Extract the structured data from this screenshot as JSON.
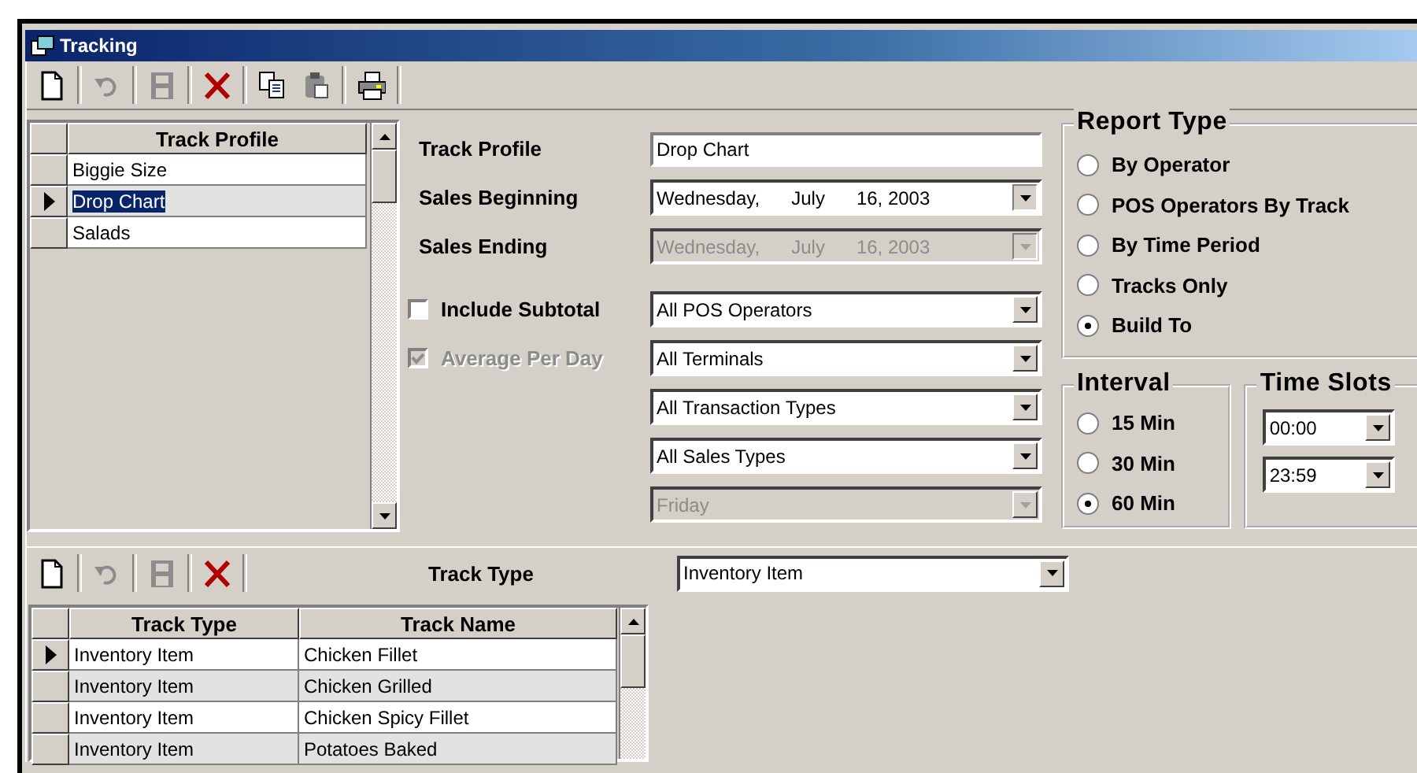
{
  "window": {
    "title": "Tracking"
  },
  "toolbar": {
    "groups": [
      {
        "items": [
          {
            "kind": "new",
            "disabled": false
          }
        ]
      },
      {
        "items": [
          {
            "kind": "undo",
            "disabled": true
          }
        ]
      },
      {
        "items": [
          {
            "kind": "save",
            "disabled": true
          }
        ]
      },
      {
        "items": [
          {
            "kind": "delete",
            "disabled": false
          }
        ]
      },
      {
        "items": [
          {
            "kind": "copy",
            "disabled": false
          },
          {
            "kind": "paste",
            "disabled": true
          }
        ]
      },
      {
        "items": [
          {
            "kind": "print",
            "disabled": false
          }
        ]
      }
    ]
  },
  "profile_grid": {
    "column": "Track Profile",
    "rows": [
      {
        "name": "Biggie Size",
        "selected": false
      },
      {
        "name": "Drop Chart",
        "selected": true
      },
      {
        "name": "Salads",
        "selected": false
      }
    ]
  },
  "form": {
    "fields": [
      {
        "label": "Track Profile",
        "kind": "text",
        "value": "Drop Chart",
        "disabled": false
      },
      {
        "label": "Sales Beginning",
        "kind": "date",
        "value": "Wednesday,      July      16, 2003",
        "disabled": false
      },
      {
        "label": "Sales Ending",
        "kind": "date",
        "value": "Wednesday,      July      16, 2003",
        "disabled": true
      }
    ],
    "options": [
      {
        "checkbox": {
          "label": "Include Subtotal",
          "checked": false,
          "disabled": false
        },
        "dropdown": {
          "value": "All POS Operators",
          "disabled": false
        }
      },
      {
        "checkbox": {
          "label": "Average Per Day",
          "checked": true,
          "disabled": true
        },
        "dropdown": {
          "value": "All Terminals",
          "disabled": false
        }
      },
      {
        "dropdown": {
          "value": "All Transaction Types",
          "disabled": false
        }
      },
      {
        "dropdown": {
          "value": "All Sales Types",
          "disabled": false
        }
      },
      {
        "dropdown": {
          "value": "Friday",
          "disabled": true
        }
      }
    ]
  },
  "report_type": {
    "title": "Report Type",
    "options": [
      {
        "label": "By Operator",
        "selected": false
      },
      {
        "label": "POS Operators By Track",
        "selected": false
      },
      {
        "label": "By Time Period",
        "selected": false
      },
      {
        "label": "Tracks Only",
        "selected": false
      },
      {
        "label": "Build To",
        "selected": true
      }
    ]
  },
  "interval": {
    "title": "Interval",
    "options": [
      {
        "label": "15 Min",
        "selected": false
      },
      {
        "label": "30 Min",
        "selected": false
      },
      {
        "label": "60 Min",
        "selected": true
      }
    ]
  },
  "time_slots": {
    "title": "Time Slots",
    "values": [
      "00:00",
      "23:59"
    ]
  },
  "bottom_toolbar": {
    "groups": [
      {
        "items": [
          {
            "kind": "new",
            "disabled": false
          }
        ]
      },
      {
        "items": [
          {
            "kind": "undo",
            "disabled": true
          }
        ]
      },
      {
        "items": [
          {
            "kind": "save",
            "disabled": true
          }
        ]
      },
      {
        "items": [
          {
            "kind": "delete",
            "disabled": false
          }
        ]
      }
    ]
  },
  "track_type": {
    "label": "Track Type",
    "value": "Inventory Item"
  },
  "track_grid": {
    "columns": [
      "Track Type",
      "Track Name"
    ],
    "rows": [
      {
        "cells": [
          "Inventory Item",
          "Chicken Fillet"
        ],
        "selected": true
      },
      {
        "cells": [
          "Inventory Item",
          "Chicken Grilled"
        ],
        "selected": false
      },
      {
        "cells": [
          "Inventory Item",
          "Chicken Spicy Fillet"
        ],
        "selected": false
      },
      {
        "cells": [
          "Inventory Item",
          "Potatoes Baked"
        ],
        "selected": false
      }
    ]
  }
}
